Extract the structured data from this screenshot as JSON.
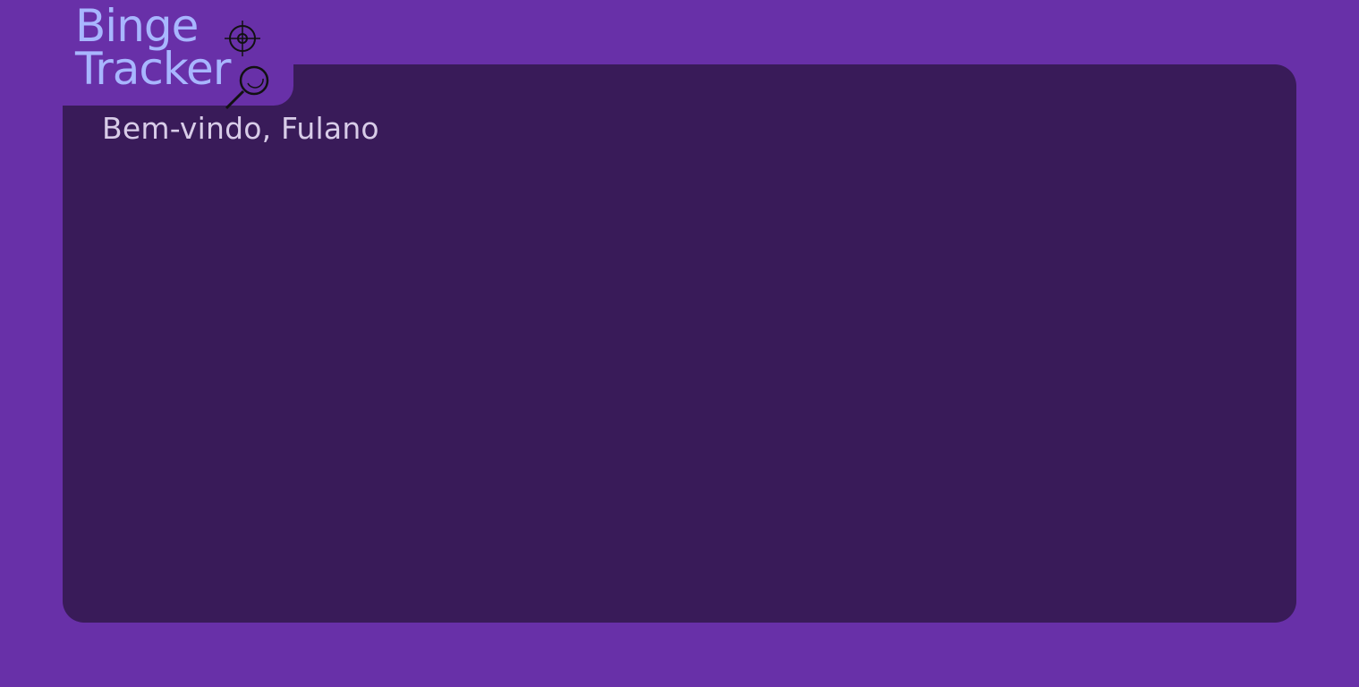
{
  "app": {
    "logo_line1": "Binge",
    "logo_line2": "Tracker"
  },
  "header": {
    "welcome": "Bem-vindo, Fulano"
  },
  "colors": {
    "background": "#6830a8",
    "panel": "#391b59",
    "logo_text": "#a8b6ff",
    "welcome_text": "#d8cce8"
  },
  "icons": {
    "logo_mark": "target-and-magnifier-icon"
  }
}
